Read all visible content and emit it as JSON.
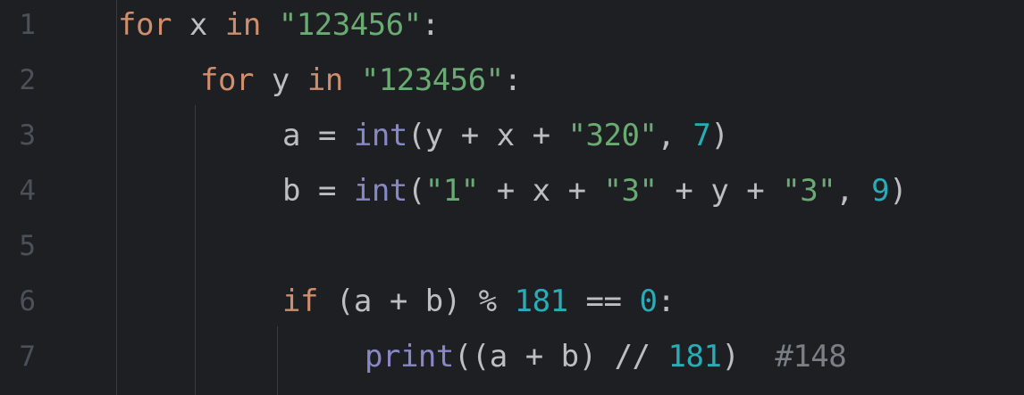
{
  "editor": {
    "lines": [
      {
        "num": "1",
        "indent": 0,
        "tokens": [
          {
            "t": "for",
            "c": "kw"
          },
          {
            "t": " ",
            "c": "id"
          },
          {
            "t": "x",
            "c": "id"
          },
          {
            "t": " ",
            "c": "id"
          },
          {
            "t": "in",
            "c": "kw"
          },
          {
            "t": " ",
            "c": "id"
          },
          {
            "t": "\"123456\"",
            "c": "str"
          },
          {
            "t": ":",
            "c": "id"
          }
        ]
      },
      {
        "num": "2",
        "indent": 1,
        "tokens": [
          {
            "t": "for",
            "c": "kw"
          },
          {
            "t": " ",
            "c": "id"
          },
          {
            "t": "y",
            "c": "id"
          },
          {
            "t": " ",
            "c": "id"
          },
          {
            "t": "in",
            "c": "kw"
          },
          {
            "t": " ",
            "c": "id"
          },
          {
            "t": "\"123456\"",
            "c": "str"
          },
          {
            "t": ":",
            "c": "id"
          }
        ]
      },
      {
        "num": "3",
        "indent": 2,
        "tokens": [
          {
            "t": "a = ",
            "c": "id"
          },
          {
            "t": "int",
            "c": "fn"
          },
          {
            "t": "(y + x + ",
            "c": "id"
          },
          {
            "t": "\"320\"",
            "c": "str"
          },
          {
            "t": ", ",
            "c": "id"
          },
          {
            "t": "7",
            "c": "num"
          },
          {
            "t": ")",
            "c": "id"
          }
        ]
      },
      {
        "num": "4",
        "indent": 2,
        "tokens": [
          {
            "t": "b = ",
            "c": "id"
          },
          {
            "t": "int",
            "c": "fn"
          },
          {
            "t": "(",
            "c": "id"
          },
          {
            "t": "\"1\"",
            "c": "str"
          },
          {
            "t": " + x + ",
            "c": "id"
          },
          {
            "t": "\"3\"",
            "c": "str"
          },
          {
            "t": " + y + ",
            "c": "id"
          },
          {
            "t": "\"3\"",
            "c": "str"
          },
          {
            "t": ", ",
            "c": "id"
          },
          {
            "t": "9",
            "c": "num"
          },
          {
            "t": ")",
            "c": "id"
          }
        ]
      },
      {
        "num": "5",
        "indent": 2,
        "tokens": []
      },
      {
        "num": "6",
        "indent": 2,
        "tokens": [
          {
            "t": "if",
            "c": "kw"
          },
          {
            "t": " (a + b) % ",
            "c": "id"
          },
          {
            "t": "181",
            "c": "num"
          },
          {
            "t": " == ",
            "c": "id"
          },
          {
            "t": "0",
            "c": "num"
          },
          {
            "t": ":",
            "c": "id"
          }
        ]
      },
      {
        "num": "7",
        "indent": 3,
        "tokens": [
          {
            "t": "print",
            "c": "fn"
          },
          {
            "t": "((a + b) // ",
            "c": "id"
          },
          {
            "t": "181",
            "c": "num"
          },
          {
            "t": ")  ",
            "c": "id"
          },
          {
            "t": "#148",
            "c": "cmt"
          }
        ]
      }
    ]
  }
}
